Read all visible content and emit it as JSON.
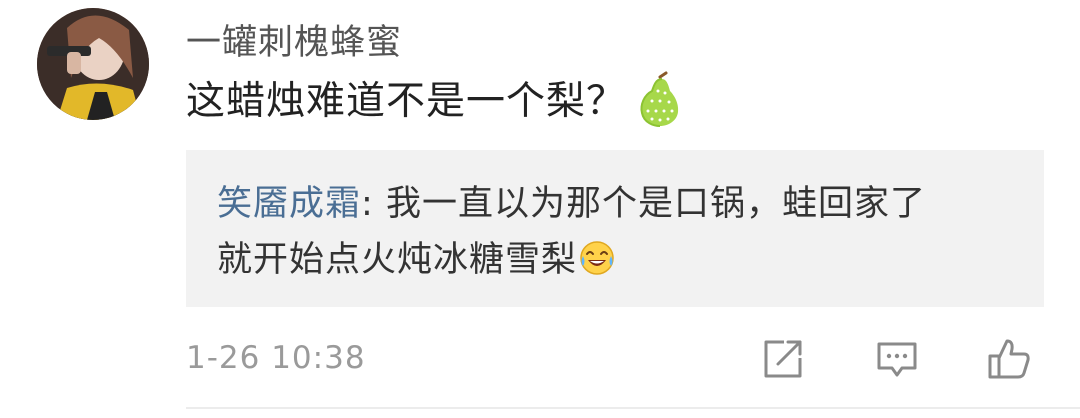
{
  "comment": {
    "username": "一罐刺槐蜂蜜",
    "text": "这蜡烛难道不是一个梨？",
    "emoji_icon": "pear-icon",
    "timestamp": "1-26 10:38"
  },
  "reply": {
    "username": "笑靥成霜",
    "separator": ": ",
    "text_line1": "我一直以为那个是口锅，蛙回家了",
    "text_line2": "就开始点火炖冰糖雪梨",
    "emoji_icon": "laugh-cry-icon",
    "link_color": "#4a6e94"
  },
  "actions": [
    "share-icon",
    "comment-icon",
    "like-icon"
  ]
}
